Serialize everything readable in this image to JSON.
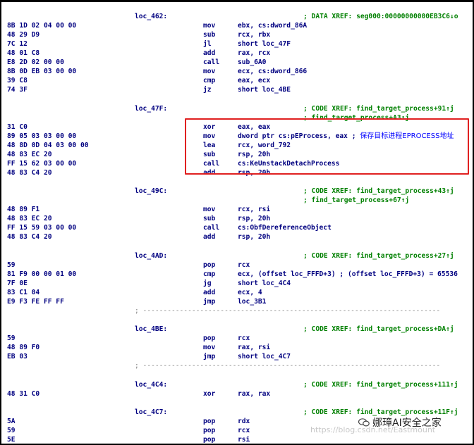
{
  "rows": [
    {
      "label": "loc_462:",
      "comment": "; DATA XREF: seg000:00000000000EB3C6↓o"
    },
    {
      "bytes": "8B 1D 02 04 00 00",
      "mn": "mov",
      "op": "ebx, cs:dword_86A"
    },
    {
      "bytes": "48 29 D9",
      "mn": "sub",
      "op": "rcx, rbx"
    },
    {
      "bytes": "7C 12",
      "mn": "jl",
      "op": "short loc_47F"
    },
    {
      "bytes": "48 01 C8",
      "mn": "add",
      "op": "rax, rcx"
    },
    {
      "bytes": "E8 2D 02 00 00",
      "mn": "call",
      "op": "sub_6A0"
    },
    {
      "bytes": "8B 0D EB 03 00 00",
      "mn": "mov",
      "op": "ecx, cs:dword_866"
    },
    {
      "bytes": "39 C8",
      "mn": "cmp",
      "op": "eax, ecx"
    },
    {
      "bytes": "74 3F",
      "mn": "jz",
      "op": "short loc_4BE"
    },
    {},
    {
      "label": "loc_47F:",
      "comment": "; CODE XREF: find_target_process+91↑j"
    },
    {
      "comment": "; find_target_process+A3↑j ..."
    },
    {
      "bytes": "31 C0",
      "mn": "xor",
      "op": "eax, eax"
    },
    {
      "bytes": "89 05 03 03 00 00",
      "mn": "mov",
      "op": "dword ptr cs:pEProcess, eax ; ",
      "cn": "保存目标进程EPROCESS地址"
    },
    {
      "bytes": "48 8D 0D 04 03 00 00",
      "mn": "lea",
      "op": "rcx, word_792"
    },
    {
      "bytes": "48 83 EC 20",
      "mn": "sub",
      "op": "rsp, 20h"
    },
    {
      "bytes": "FF 15 62 03 00 00",
      "mn": "call",
      "op": "cs:KeUnstackDetachProcess"
    },
    {
      "bytes": "48 83 C4 20",
      "mn": "add",
      "op": "rsp, 20h"
    },
    {},
    {
      "label": "loc_49C:",
      "comment": "; CODE XREF: find_target_process+43↑j"
    },
    {
      "comment": "; find_target_process+67↑j"
    },
    {
      "bytes": "48 89 F1",
      "mn": "mov",
      "op": "rcx, rsi"
    },
    {
      "bytes": "48 83 EC 20",
      "mn": "sub",
      "op": "rsp, 20h"
    },
    {
      "bytes": "FF 15 59 03 00 00",
      "mn": "call",
      "op": "cs:ObfDereferenceObject"
    },
    {
      "bytes": "48 83 C4 20",
      "mn": "add",
      "op": "rsp, 20h"
    },
    {},
    {
      "label": "loc_4AD:",
      "comment": "; CODE XREF: find_target_process+27↑j"
    },
    {
      "bytes": "59",
      "mn": "pop",
      "op": "rcx"
    },
    {
      "bytes": "81 F9 00 00 01 00",
      "mn": "cmp",
      "op": "ecx, (offset loc_FFFD+3) ; (offset loc_FFFD+3) = 65536"
    },
    {
      "bytes": "7F 0E",
      "mn": "jg",
      "op": "short loc_4C4"
    },
    {
      "bytes": "83 C1 04",
      "mn": "add",
      "op": "ecx, 4"
    },
    {
      "bytes": "E9 F3 FE FF FF",
      "mn": "jmp",
      "op": "loc_3B1"
    },
    {
      "sep": "; -------------------------------------------------------------------------"
    },
    {},
    {
      "label": "loc_4BE:",
      "comment": "; CODE XREF: find_target_process+DA↑j"
    },
    {
      "bytes": "59",
      "mn": "pop",
      "op": "rcx"
    },
    {
      "bytes": "48 89 F0",
      "mn": "mov",
      "op": "rax, rsi"
    },
    {
      "bytes": "EB 03",
      "mn": "jmp",
      "op": "short loc_4C7"
    },
    {
      "sep": "; -------------------------------------------------------------------------"
    },
    {},
    {
      "label": "loc_4C4:",
      "comment": "; CODE XREF: find_target_process+111↑j"
    },
    {
      "bytes": "48 31 C0",
      "mn": "xor",
      "op": "rax, rax"
    },
    {},
    {
      "label": "loc_4C7:",
      "comment": "; CODE XREF: find_target_process+11F↑j"
    },
    {
      "bytes": "5A",
      "mn": "pop",
      "op": "rdx"
    },
    {
      "bytes": "59",
      "mn": "pop",
      "op": "rcx"
    },
    {
      "bytes": "5E",
      "mn": "pop",
      "op": "rsi"
    }
  ],
  "watermark": {
    "brand": "娜璋AI安全之家",
    "url": "https://blog.csdn.net/Eastmount"
  },
  "colors": {
    "code": "#000080",
    "comment": "#008000",
    "highlight_box": "#e02020"
  }
}
